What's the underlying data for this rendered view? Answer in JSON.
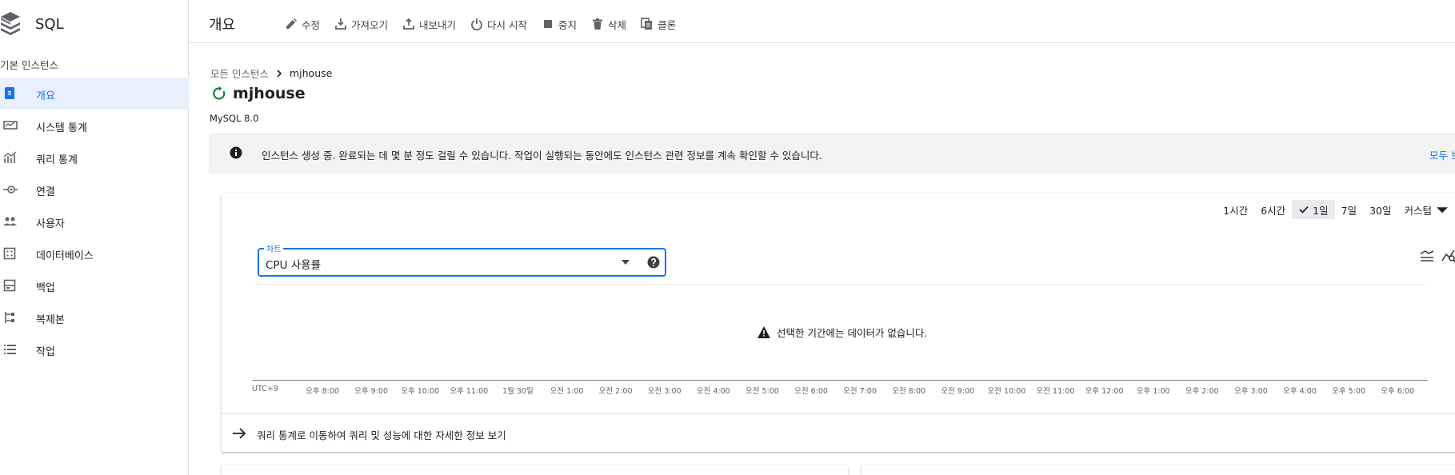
{
  "app": {
    "title": "SQL"
  },
  "sidebar": {
    "section_label": "기본 인스턴스",
    "items": [
      {
        "label": "개요",
        "icon": "overview-icon",
        "active": true
      },
      {
        "label": "시스템 통계",
        "icon": "monitor-icon",
        "active": false
      },
      {
        "label": "쿼리 통계",
        "icon": "analytics-icon",
        "active": false
      },
      {
        "label": "연결",
        "icon": "connection-icon",
        "active": false
      },
      {
        "label": "사용자",
        "icon": "users-icon",
        "active": false
      },
      {
        "label": "데이터베이스",
        "icon": "database-icon",
        "active": false
      },
      {
        "label": "백업",
        "icon": "backup-icon",
        "active": false
      },
      {
        "label": "복제본",
        "icon": "replica-icon",
        "active": false
      },
      {
        "label": "작업",
        "icon": "list-icon",
        "active": false
      }
    ]
  },
  "header": {
    "title": "개요",
    "toolbar": {
      "edit": "수정",
      "import": "가져오기",
      "export": "내보내기",
      "restart": "다시 시작",
      "stop": "중지",
      "delete": "삭제",
      "clone": "클론"
    }
  },
  "breadcrumb": {
    "parent": "모든 인스턴스",
    "current": "mjhouse"
  },
  "instance": {
    "name": "mjhouse",
    "version": "MySQL 8.0",
    "status_color": "#188038"
  },
  "banner": {
    "text": "인스턴스 생성 중. 완료되는 데 몇 분 정도 걸릴 수 있습니다. 작업이 실행되는 동안에도 인스턴스 관련 정보를 계속 확인할 수 있습니다.",
    "link": "모두 보기"
  },
  "time_range": {
    "options": [
      "1시간",
      "6시간",
      "1일",
      "7일",
      "30일",
      "커스텀"
    ],
    "selected": "1일"
  },
  "chart": {
    "select_label": "차트",
    "select_value": "CPU 사용률",
    "no_data": "선택한 기간에는 데이터가 없습니다.",
    "timezone": "UTC+9",
    "x_ticks": [
      "오후 8:00",
      "오후 9:00",
      "오후 10:00",
      "오후 11:00",
      "1월 30일",
      "오전 1:00",
      "오전 2:00",
      "오전 3:00",
      "오전 4:00",
      "오전 5:00",
      "오전 6:00",
      "오전 7:00",
      "오전 8:00",
      "오전 9:00",
      "오전 10:00",
      "오전 11:00",
      "오후 12:00",
      "오후 1:00",
      "오후 2:00",
      "오후 3:00",
      "오후 4:00",
      "오후 5:00",
      "오후 6:00"
    ]
  },
  "footer_link": "쿼리 통계로 이동하여 쿼리 및 성능에 대한 자세한 정보 보기",
  "colors": {
    "accent": "#1a73e8",
    "active_bg": "#e8f0fe",
    "banner_bg": "#f1f3f4"
  }
}
